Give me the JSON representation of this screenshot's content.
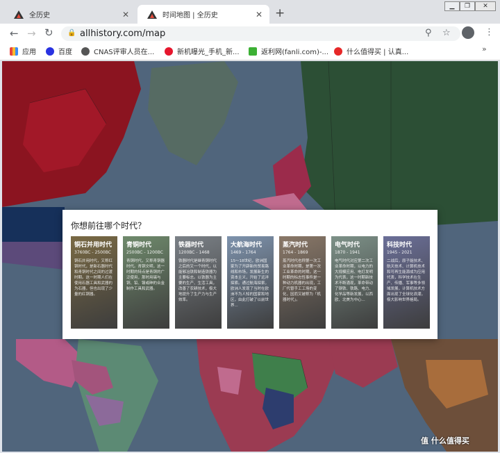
{
  "browser": {
    "tabs": [
      {
        "title": "全历史",
        "active": false
      },
      {
        "title": "时间地图 | 全历史",
        "active": true
      }
    ],
    "new_tab": "+",
    "url": "allhistory.com/map",
    "bookmarks": [
      {
        "label": "应用",
        "color": "#e8453c"
      },
      {
        "label": "百度",
        "color": "#2932e1"
      },
      {
        "label": "CNAS评审人员在...",
        "color": "#555555"
      },
      {
        "label": "新机曝光_手机_新...",
        "color": "#e6162d"
      },
      {
        "label": "返利网(fanli.com)-...",
        "color": "#3cb034"
      },
      {
        "label": "什么值得买 | 认真...",
        "color": "#e62828"
      }
    ],
    "more_bookmarks": "»"
  },
  "modal": {
    "title": "你想前往哪个时代？",
    "eras": [
      {
        "name": "铜石并用时代",
        "range": "3760BC - 2500BC",
        "desc": "铜石并用时代，又称红铜时代，是新石器时代和青铜时代之间的过渡时期。这一时期人们在使用石器工具和武器的为石器，但也出现了少量的红铜器。",
        "color": "#7a6a44"
      },
      {
        "name": "青铜时代",
        "range": "2500BC - 1200BC",
        "desc": "青铜时代，又称青铜器时代。青铜文明，这一时期的特点是青铜的广泛使用，那时用锡与铜、铅、镍或砷的合金制作工具和武器。",
        "color": "#6f8a6c"
      },
      {
        "name": "铁器时代",
        "range": "1200BC - 1468",
        "desc": "铁器时代是继青铜时代之后的又一个时代，以能够冶铁和制造铁器为主要标志。以铁器为主要的生产、生活工具，改善了农耕技术，极大地提升了生产力与生产效率。",
        "color": "#7b8187"
      },
      {
        "name": "大航海时代",
        "range": "1469 - 1764",
        "desc": "15～18世纪，欧洲国家为了开辟新的贸易路线和市场，发展新生的资本主义，开始了远洋探索。通过航海探索，欧洲人发现了当时在欧洲不为人知的国家和地区，由此打破了以前世界...",
        "color": "#7e93ad"
      },
      {
        "name": "蒸汽时代",
        "range": "1764 - 1869",
        "desc": "蒸汽时代也称第一次工业革命时期，是第一次工业革命的时期，这一时期的标志性事件是一种动力机器的出现，工厂代替手工工场的变化，因而又被称为「机器时代」。",
        "color": "#8a7868"
      },
      {
        "name": "电气时代",
        "range": "1870 - 1941",
        "desc": "电气时代对应第二次工业革命时期，以电力的大规模应用、电灯发明为代表，这一时期新技术不断涌现，革命带动了钢铁、铁路、电力、化学品等新发展，以西欧、北美为中心...",
        "color": "#7d9188"
      },
      {
        "name": "科技时代",
        "range": "1945 - 2021",
        "desc": "二战后，原子能技术、航天技术、计算机技术和可再生能源成为应用代表，科学技术在生产、传播、军事等多领域发展，计算机技术方面出现了全球化浪潮，极大影响世界格局。",
        "color": "#6b6f98"
      }
    ]
  },
  "watermark": "值 什么值得买"
}
